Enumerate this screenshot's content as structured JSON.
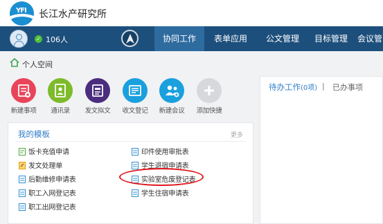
{
  "header": {
    "brand": "长江水产研究所"
  },
  "nav": {
    "online_count": "106人",
    "tabs": [
      {
        "label": "协同工作",
        "active": true
      },
      {
        "label": "表单应用",
        "active": false
      },
      {
        "label": "公文管理",
        "active": false
      },
      {
        "label": "目标管理",
        "active": false
      },
      {
        "label": "会议管",
        "active": false
      }
    ]
  },
  "breadcrumb": {
    "label": "个人空间"
  },
  "apps": [
    {
      "label": "新建事项",
      "color": "#e8455a",
      "icon": "new-item-icon"
    },
    {
      "label": "通讯录",
      "color": "#7dbb2a",
      "icon": "contacts-icon"
    },
    {
      "label": "发文拟文",
      "color": "#4a2d7e",
      "icon": "draft-document-icon"
    },
    {
      "label": "收文登记",
      "color": "#1aa0de",
      "icon": "receive-document-icon"
    },
    {
      "label": "新建会议",
      "color": "#1aa0de",
      "icon": "new-meeting-icon"
    },
    {
      "label": "添加快捷",
      "color": "#d6d8db",
      "icon": "plus-icon"
    }
  ],
  "templates": {
    "title": "我的模板",
    "more": "更多",
    "items": [
      {
        "label": "饭卡充值申请",
        "icon_color": "#4caa3c"
      },
      {
        "label": "印件使用审批表",
        "icon_color": "#2f8fd0"
      },
      {
        "label": "发文处理单",
        "icon_color": "#e6a117"
      },
      {
        "label": "学生退宿申请表",
        "icon_color": "#2f8fd0"
      },
      {
        "label": "后勤维修申请表",
        "icon_color": "#2f8fd0"
      },
      {
        "label": "实验室危废登记表",
        "icon_color": "#2f8fd0"
      },
      {
        "label": "职工入网登记表",
        "icon_color": "#2f8fd0"
      },
      {
        "label": "学生住宿申请表",
        "icon_color": "#2f8fd0"
      },
      {
        "label": "职工出网登记表",
        "icon_color": "#2f8fd0"
      }
    ]
  },
  "work": {
    "pending_label": "待办工作",
    "pending_count": "(0项)",
    "separator": "|",
    "done_label": "已办事项"
  }
}
